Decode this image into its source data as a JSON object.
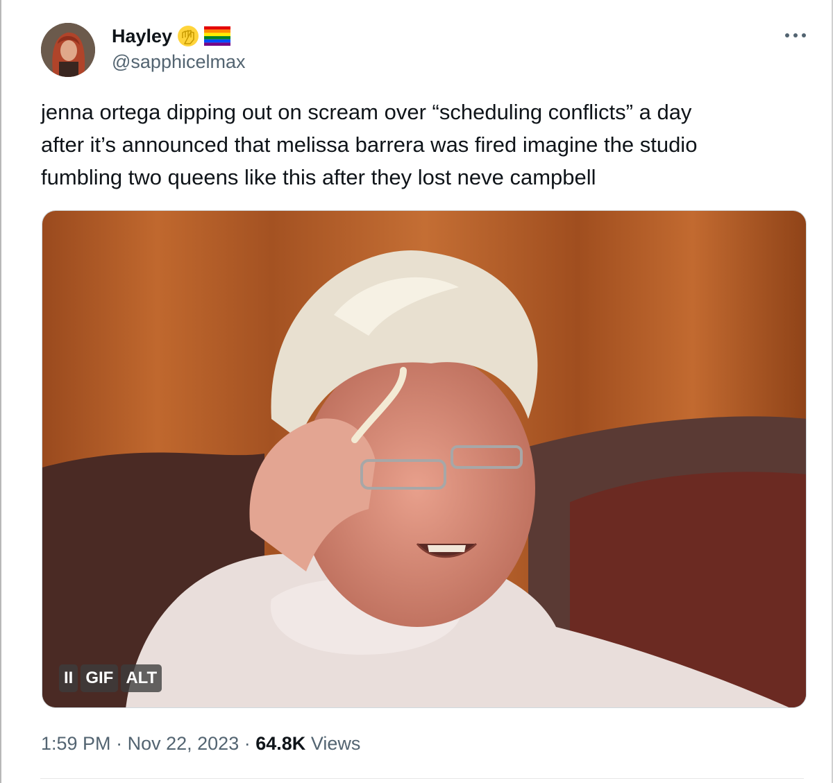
{
  "author": {
    "display_name": "Hayley",
    "badges": [
      "raised-fist-emoji",
      "rainbow-flag-emoji"
    ],
    "handle": "@sapphicelmax"
  },
  "tweet": {
    "lines": [
      "jenna ortega dipping out on scream over “scheduling conflicts” a day",
      "after it’s announced that melissa barrera was fired imagine the studio",
      "fumbling two queens like this after they lost neve campbell"
    ]
  },
  "media": {
    "pause_label": "II",
    "gif_label": "GIF",
    "alt_label": "ALT"
  },
  "meta": {
    "time": "1:59 PM",
    "separator": "·",
    "date": "Nov 22, 2023",
    "views_count": "64.8K",
    "views_label": "Views"
  },
  "colors": {
    "text_primary": "#0f1419",
    "text_secondary": "#536471",
    "border": "#cfd9de"
  }
}
